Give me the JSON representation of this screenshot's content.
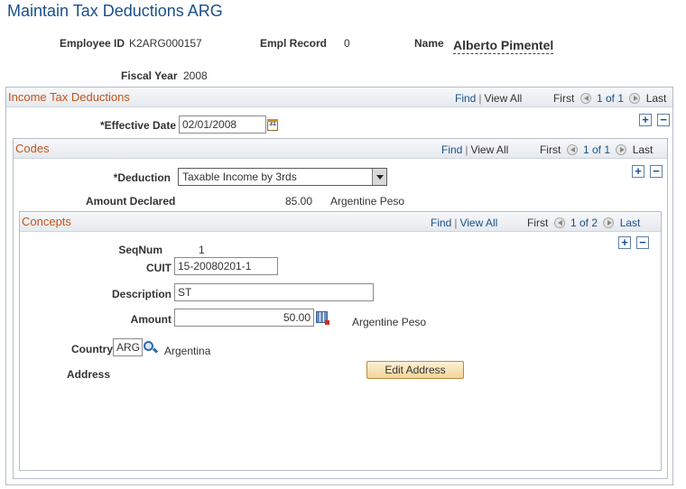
{
  "page": {
    "title": "Maintain Tax Deductions ARG"
  },
  "header": {
    "employee_id_label": "Employee ID",
    "employee_id_value": "K2ARG000157",
    "empl_record_label": "Empl Record",
    "empl_record_value": "0",
    "name_label": "Name",
    "name_value": "Alberto Pimentel",
    "fiscal_year_label": "Fiscal Year",
    "fiscal_year_value": "2008"
  },
  "income_tax": {
    "title": "Income Tax Deductions",
    "find": "Find",
    "view_all": "View All",
    "first": "First",
    "pager": "1 of 1",
    "last": "Last",
    "effective_date_label": "*Effective Date",
    "effective_date_value": "02/01/2008"
  },
  "codes": {
    "title": "Codes",
    "find": "Find",
    "view_all": "View All",
    "first": "First",
    "pager": "1 of 1",
    "last": "Last",
    "deduction_label": "*Deduction",
    "deduction_value": "Taxable Income by 3rds",
    "amount_declared_label": "Amount Declared",
    "amount_declared_value": "85.00",
    "amount_declared_currency": "Argentine Peso"
  },
  "concepts": {
    "title": "Concepts",
    "find": "Find",
    "view_all": "View All",
    "first": "First",
    "pager": "1 of 2",
    "last": "Last",
    "seqnum_label": "SeqNum",
    "seqnum_value": "1",
    "cuit_label": "CUIT",
    "cuit_value": "15-20080201-1",
    "description_label": "Description",
    "description_value": "ST",
    "amount_label": "Amount",
    "amount_value": "50.00",
    "amount_currency": "Argentine Peso",
    "country_label": "Country",
    "country_value": "ARG",
    "country_name": "Argentina",
    "address_label": "Address",
    "edit_address_button": "Edit Address"
  },
  "icons": {
    "add": "+",
    "delete": "−",
    "calendar": "31"
  },
  "colors": {
    "title": "#1a4f8b",
    "section_title": "#c2561a",
    "link": "#1a4f8b",
    "button_bg": "#f2d59a"
  }
}
